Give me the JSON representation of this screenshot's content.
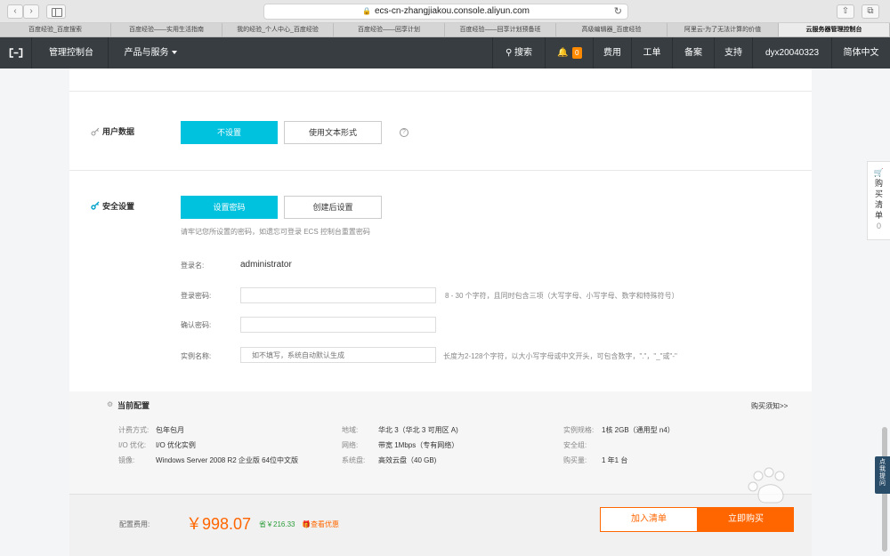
{
  "browser": {
    "url": "ecs-cn-zhangjiakou.console.aliyun.com",
    "tabs": [
      "百度经验_百度搜索",
      "百度经验——实用生活指南",
      "我的经验_个人中心_百度经验",
      "百度经验——回享计划",
      "百度经验——回享计划预备班",
      "高级编辑器_百度经验",
      "阿里云-为了无法计算的价值",
      "云服务器管理控制台"
    ],
    "active_tab_index": 7
  },
  "topnav": {
    "console": "管理控制台",
    "products": "产品与服务",
    "search": "搜索",
    "bell_count": "0",
    "billing": "费用",
    "tickets": "工单",
    "icp": "备案",
    "support": "支持",
    "user": "dyx20040323",
    "language": "简体中文"
  },
  "user_data": {
    "label": "用户数据",
    "option_none": "不设置",
    "option_text": "使用文本形式"
  },
  "security": {
    "label": "安全设置",
    "option_set_password": "设置密码",
    "option_later": "创建后设置",
    "hint": "请牢记您所设置的密码，如遗忘可登录 ECS 控制台重置密码",
    "login_name_label": "登录名:",
    "login_name_value": "administrator",
    "password_label": "登录密码:",
    "password_hint": "8 - 30 个字符，且同时包含三项（大写字母、小写字母、数字和特殊符号）",
    "confirm_label": "确认密码:",
    "instance_name_label": "实例名称:",
    "instance_name_placeholder": "如不填写，系统自动默认生成",
    "instance_name_hint": "长度为2-128个字符，以大小写字母或中文开头，可包含数字，\".\"，\"_\"或\"-\""
  },
  "config": {
    "title": "当前配置",
    "purchase_notice": "购买须知>>",
    "billing_label": "计费方式:",
    "billing_value": "包年包月",
    "io_label": "I/O 优化:",
    "io_value": "I/O 优化实例",
    "image_label": "镜像:",
    "image_value": "Windows Server 2008 R2 企业版 64位中文版",
    "region_label": "地域:",
    "region_value": "华北 3（华北 3 可用区 A)",
    "network_label": "网络:",
    "network_value": "带宽 1Mbps（专有网络）",
    "disk_label": "系统盘:",
    "disk_value": "高效云盘（40 GB)",
    "spec_label": "实例规格:",
    "spec_value": "1核 2GB（通用型 n4）",
    "secgroup_label": "安全组:",
    "secgroup_value": "",
    "qty_label": "购买量:",
    "qty_value": "1 年1 台"
  },
  "bottom": {
    "fee_label": "配置费用:",
    "price": "￥998.07",
    "save": "省￥216.33",
    "promo": "查看优惠",
    "add_cart": "加入清单",
    "buy_now": "立即购买"
  },
  "float_cart": {
    "chars": [
      "购",
      "买",
      "清",
      "单"
    ],
    "count": "0"
  },
  "float_ask": {
    "chars": [
      "点",
      "我",
      "提",
      "问"
    ]
  },
  "colors": {
    "primary": "#00c1de",
    "nav_bg": "#373d41",
    "accent_orange": "#ff6600"
  }
}
